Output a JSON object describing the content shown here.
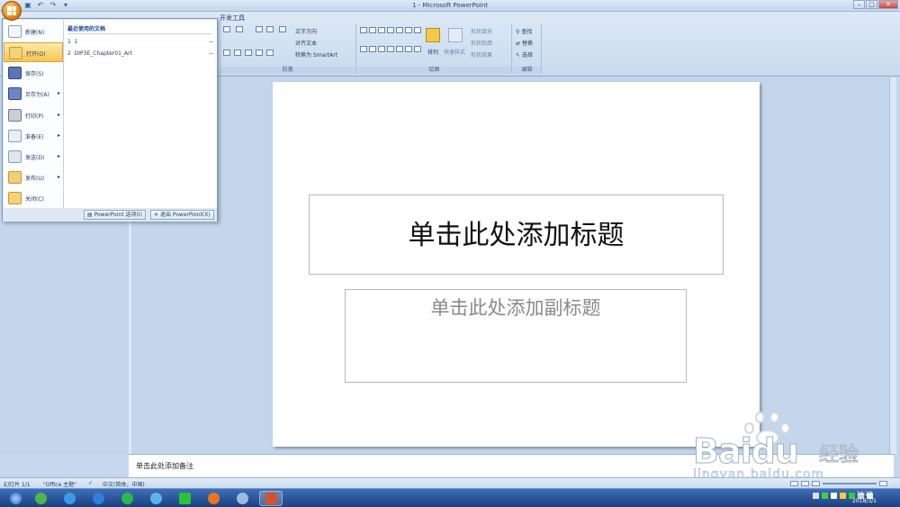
{
  "window": {
    "title": "1 - Microsoft PowerPoint"
  },
  "ribbon": {
    "tab_partial": "开发工具",
    "paragraph": {
      "label": "段落",
      "text_direction": "文字方向",
      "align_text": "对齐文本",
      "convert_smartart": "转换为 SmartArt"
    },
    "drawing": {
      "label": "绘图",
      "arrange": "排列",
      "quick_styles": "快速样式",
      "shape_fill": "形状填充",
      "shape_outline": "形状轮廓",
      "shape_effects": "形状效果"
    },
    "editing": {
      "label": "编辑",
      "find": "查找",
      "replace": "替换",
      "select": "选择"
    }
  },
  "office_menu": {
    "items": [
      {
        "label": "新建(N)",
        "icon": "new-doc-icon",
        "arrow": false
      },
      {
        "label": "打开(O)",
        "icon": "open-folder-icon",
        "arrow": false,
        "highlighted": true
      },
      {
        "label": "保存(S)",
        "icon": "save-disk-icon",
        "arrow": false
      },
      {
        "label": "另存为(A)",
        "icon": "save-as-icon",
        "arrow": true
      },
      {
        "label": "打印(P)",
        "icon": "printer-icon",
        "arrow": true
      },
      {
        "label": "准备(E)",
        "icon": "prepare-icon",
        "arrow": true
      },
      {
        "label": "发送(D)",
        "icon": "send-icon",
        "arrow": true
      },
      {
        "label": "发布(U)",
        "icon": "publish-icon",
        "arrow": true
      },
      {
        "label": "关闭(C)",
        "icon": "close-folder-icon",
        "arrow": false
      }
    ],
    "recent_header": "最近使用的文档",
    "recent": [
      {
        "num": "1",
        "name": "1"
      },
      {
        "num": "2",
        "name": "DIP3E_Chapter01_Art"
      }
    ],
    "options_button": "PowerPoint 选项(I)",
    "exit_button": "退出 PowerPoint(X)"
  },
  "slide": {
    "title_placeholder": "单击此处添加标题",
    "subtitle_placeholder": "单击此处添加副标题"
  },
  "notes": {
    "placeholder": "单击此处添加备注"
  },
  "status": {
    "slide": "幻灯片 1/1",
    "theme": "\"Office 主题\"",
    "language": "中文(简体，中国)"
  },
  "taskbar": {
    "time": "16:27",
    "date": "2018/3/1"
  },
  "watermark": {
    "brand": "Baidu",
    "cn": "经验",
    "url": "jingyan.baidu.com"
  }
}
